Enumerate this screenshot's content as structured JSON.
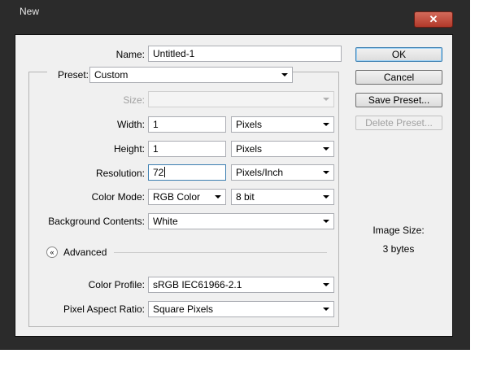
{
  "window": {
    "title": "New",
    "close_glyph": "✕"
  },
  "form": {
    "name": {
      "label": "Name:",
      "value": "Untitled-1"
    },
    "preset": {
      "label": "Preset:",
      "value": "Custom"
    },
    "size": {
      "label": "Size:",
      "value": ""
    },
    "width": {
      "label": "Width:",
      "value": "1",
      "unit": "Pixels"
    },
    "height": {
      "label": "Height:",
      "value": "1",
      "unit": "Pixels"
    },
    "resolution": {
      "label": "Resolution:",
      "value": "72",
      "unit": "Pixels/Inch"
    },
    "color_mode": {
      "label": "Color Mode:",
      "value": "RGB Color",
      "depth": "8 bit"
    },
    "background": {
      "label": "Background Contents:",
      "value": "White"
    },
    "advanced": {
      "label": "Advanced",
      "icon_glyph": "«"
    },
    "color_profile": {
      "label": "Color Profile:",
      "value": "sRGB IEC61966-2.1"
    },
    "pixel_aspect": {
      "label": "Pixel Aspect Ratio:",
      "value": "Square Pixels"
    }
  },
  "buttons": {
    "ok": "OK",
    "cancel": "Cancel",
    "save_preset": "Save Preset...",
    "delete_preset": "Delete Preset..."
  },
  "image_size": {
    "label": "Image Size:",
    "value": "3 bytes"
  }
}
